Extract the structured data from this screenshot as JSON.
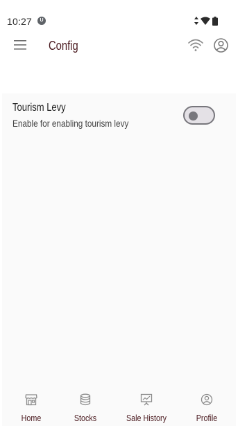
{
  "status_bar": {
    "time": "10:27",
    "notification_badge": "U"
  },
  "app_bar": {
    "title": "Config",
    "menu_icon": "hamburger-menu-icon",
    "network_icon": "wifi-icon",
    "account_icon": "account-circle-icon"
  },
  "settings": [
    {
      "title": "Tourism Levy",
      "description": "Enable for enabling tourism levy",
      "enabled": false
    }
  ],
  "bottom_nav": {
    "items": [
      {
        "label": "Home",
        "icon": "store-icon"
      },
      {
        "label": "Stocks",
        "icon": "database-stack-icon"
      },
      {
        "label": "Sale History",
        "icon": "presentation-chart-icon"
      },
      {
        "label": "Profile",
        "icon": "account-circle-icon"
      }
    ]
  },
  "colors": {
    "accent": "#4a1a1f",
    "panel_background": "#fafafa",
    "toggle_outline": "#77767c",
    "toggle_track": "#e4e1e6"
  }
}
